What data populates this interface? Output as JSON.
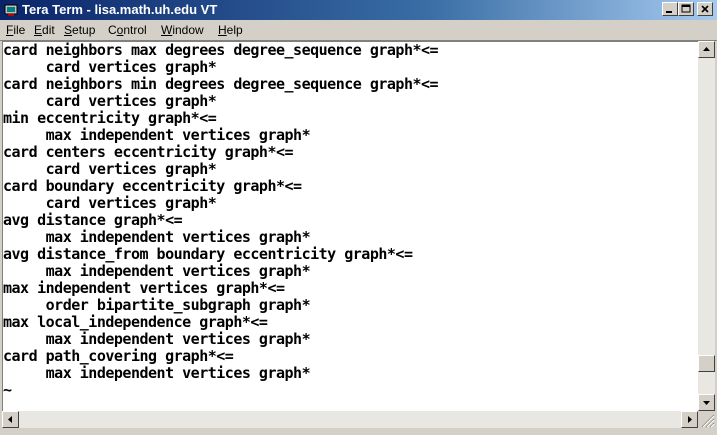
{
  "window": {
    "title": "Tera Term - lisa.math.uh.edu VT"
  },
  "menu": {
    "items": [
      {
        "key": "F",
        "rest": "ile"
      },
      {
        "key": "E",
        "rest": "dit"
      },
      {
        "key": "S",
        "rest": "etup"
      },
      {
        "pre": "C",
        "key": "o",
        "rest": "ntrol"
      },
      {
        "key": "W",
        "rest": "indow"
      },
      {
        "key": "H",
        "rest": "elp"
      }
    ]
  },
  "terminal": {
    "lines": [
      "card neighbors max degrees degree_sequence graph*<=",
      "     card vertices graph*",
      "card neighbors min degrees degree_sequence graph*<=",
      "     card vertices graph*",
      "min eccentricity graph*<=",
      "     max independent vertices graph*",
      "card centers eccentricity graph*<=",
      "     card vertices graph*",
      "card boundary eccentricity graph*<=",
      "     card vertices graph*",
      "avg distance graph*<=",
      "     max independent vertices graph*",
      "avg distance_from boundary eccentricity graph*<=",
      "     max independent vertices graph*",
      "max independent vertices graph*<=",
      "     order bipartite_subgraph graph*",
      "max local_independence graph*<=",
      "     max independent vertices graph*",
      "card path_covering graph*<=",
      "     max independent vertices graph*",
      "~"
    ]
  },
  "scroll": {
    "vertical_position": 0.93
  },
  "icons": {
    "app": "tera-term-icon",
    "minimize": "minimize-icon",
    "maximize": "maximize-icon",
    "close": "close-icon"
  },
  "colors": {
    "titlebar_start": "#0a246a",
    "titlebar_end": "#a6caf0",
    "terminal_bg": "#ffffff",
    "terminal_fg": "#000000"
  }
}
